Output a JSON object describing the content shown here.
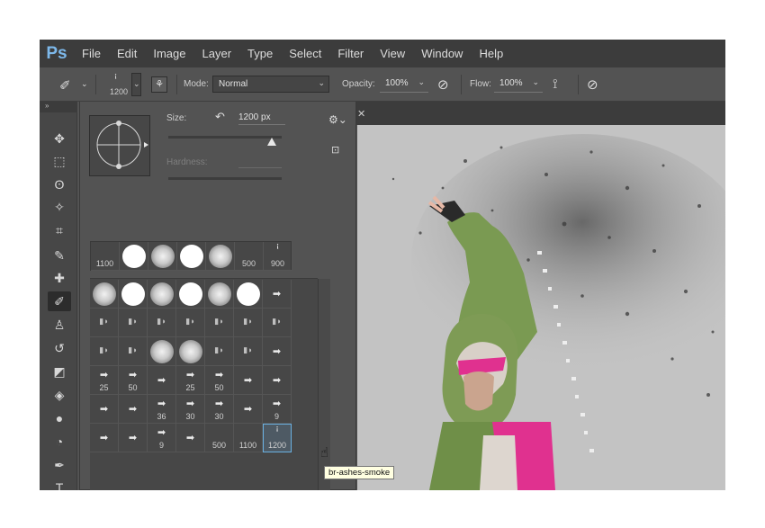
{
  "app": {
    "logo": "Ps"
  },
  "menu": [
    "File",
    "Edit",
    "Image",
    "Layer",
    "Type",
    "Select",
    "Filter",
    "View",
    "Window",
    "Help"
  ],
  "options_bar": {
    "brush_size": "1200",
    "mode_label": "Mode:",
    "mode_value": "Normal",
    "opacity_label": "Opacity:",
    "opacity_value": "100%",
    "flow_label": "Flow:",
    "flow_value": "100%"
  },
  "tools_panel": {
    "collapse_glyph": "»",
    "tools": [
      {
        "name": "move-tool",
        "icon": "✥"
      },
      {
        "name": "marquee-tool",
        "icon": "⬚"
      },
      {
        "name": "lasso-tool",
        "icon": "ʘ"
      },
      {
        "name": "magic-wand-tool",
        "icon": "✧"
      },
      {
        "name": "crop-tool",
        "icon": "⌗"
      },
      {
        "name": "eyedropper-tool",
        "icon": "✎"
      },
      {
        "name": "healing-brush-tool",
        "icon": "✚"
      },
      {
        "name": "brush-tool",
        "icon": "✐"
      },
      {
        "name": "clone-stamp-tool",
        "icon": "♙"
      },
      {
        "name": "history-brush-tool",
        "icon": "↺"
      },
      {
        "name": "eraser-tool",
        "icon": "◩"
      },
      {
        "name": "paint-bucket-tool",
        "icon": "◈"
      },
      {
        "name": "blur-tool",
        "icon": "●"
      },
      {
        "name": "dodge-tool",
        "icon": "◔"
      },
      {
        "name": "pen-tool",
        "icon": "✒"
      },
      {
        "name": "type-tool",
        "icon": "T"
      }
    ]
  },
  "brush_picker": {
    "size_label": "Size:",
    "size_value": "1200 px",
    "hardness_label": "Hardness:",
    "recent": [
      {
        "kind": "label",
        "label": "1100"
      },
      {
        "kind": "hard",
        "label": ""
      },
      {
        "kind": "soft",
        "label": ""
      },
      {
        "kind": "hard",
        "label": ""
      },
      {
        "kind": "soft",
        "label": ""
      },
      {
        "kind": "label",
        "label": "500"
      },
      {
        "kind": "smoke",
        "label": "900"
      }
    ],
    "grid": [
      [
        {
          "k": "soft",
          "l": ""
        },
        {
          "k": "hard",
          "l": ""
        },
        {
          "k": "soft",
          "l": ""
        },
        {
          "k": "hard",
          "l": ""
        },
        {
          "k": "soft",
          "l": ""
        },
        {
          "k": "hard",
          "l": ""
        },
        {
          "k": "glyph",
          "l": ""
        }
      ],
      [
        {
          "k": "dim",
          "l": ""
        },
        {
          "k": "dim",
          "l": ""
        },
        {
          "k": "dim",
          "l": ""
        },
        {
          "k": "dim",
          "l": ""
        },
        {
          "k": "dim",
          "l": ""
        },
        {
          "k": "dim",
          "l": ""
        },
        {
          "k": "dim",
          "l": ""
        }
      ],
      [
        {
          "k": "dim",
          "l": ""
        },
        {
          "k": "dim",
          "l": ""
        },
        {
          "k": "soft",
          "l": ""
        },
        {
          "k": "soft",
          "l": ""
        },
        {
          "k": "dim",
          "l": ""
        },
        {
          "k": "dim",
          "l": ""
        },
        {
          "k": "glyph",
          "l": ""
        }
      ],
      [
        {
          "k": "glyph",
          "l": "25"
        },
        {
          "k": "glyph",
          "l": "50"
        },
        {
          "k": "glyph",
          "l": ""
        },
        {
          "k": "glyph",
          "l": "25"
        },
        {
          "k": "glyph",
          "l": "50"
        },
        {
          "k": "glyph",
          "l": ""
        },
        {
          "k": "glyph",
          "l": ""
        }
      ],
      [
        {
          "k": "glyph",
          "l": ""
        },
        {
          "k": "glyph",
          "l": ""
        },
        {
          "k": "glyph",
          "l": "36"
        },
        {
          "k": "glyph",
          "l": "30"
        },
        {
          "k": "glyph",
          "l": "30"
        },
        {
          "k": "glyph",
          "l": ""
        },
        {
          "k": "glyph",
          "l": "9"
        }
      ],
      [
        {
          "k": "glyph",
          "l": ""
        },
        {
          "k": "glyph",
          "l": ""
        },
        {
          "k": "glyph",
          "l": "9"
        },
        {
          "k": "glyph",
          "l": ""
        },
        {
          "k": "empty",
          "l": "500"
        },
        {
          "k": "empty",
          "l": "1100"
        },
        {
          "k": "smoke",
          "l": "1200"
        }
      ]
    ],
    "tooltip": "br-ashes-smoke"
  }
}
